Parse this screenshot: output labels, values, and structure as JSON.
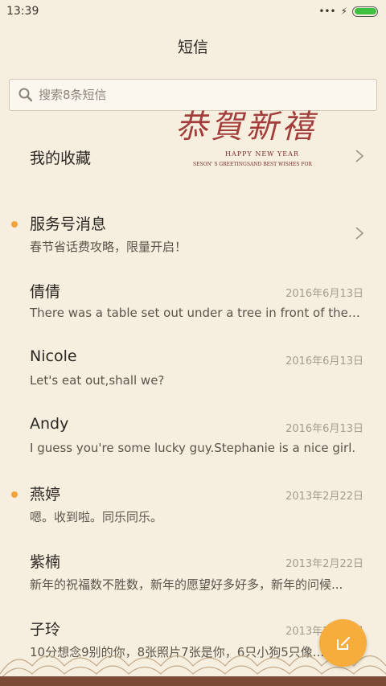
{
  "status": {
    "time": "13:39",
    "dots": "•••",
    "bolt": "⚡"
  },
  "header": {
    "title": "短信"
  },
  "search": {
    "placeholder": "搜索8条短信"
  },
  "decoration": {
    "main": "恭賀新禧",
    "sub1": "HAPPY NEW YEAR",
    "sub2": "SESON' S GREETINGSAND BEST WISHES FOR"
  },
  "conversations": [
    {
      "name": "我的收藏",
      "preview": "",
      "date": "",
      "unread": false,
      "chevron": true
    },
    {
      "name": "服务号消息",
      "preview": "春节省话费攻略，限量开启！",
      "date": "",
      "unread": true,
      "chevron": true
    },
    {
      "name": "倩倩",
      "preview": "There was a table set out under a tree in front of the ho...",
      "date": "2016年6月13日",
      "unread": false,
      "chevron": false
    },
    {
      "name": "Nicole",
      "preview": "Let's eat out,shall we?",
      "date": "2016年6月13日",
      "unread": false,
      "chevron": false
    },
    {
      "name": "Andy",
      "preview": "I guess you're some lucky guy.Stephanie is a nice girl.",
      "date": "2016年6月13日",
      "unread": false,
      "chevron": false
    },
    {
      "name": "燕婷",
      "preview": "嗯。收到啦。同乐同乐。",
      "date": "2013年2月22日",
      "unread": true,
      "chevron": false
    },
    {
      "name": "紫楠",
      "preview": "新年的祝福数不胜数，新年的愿望好多好多，新年的问候...",
      "date": "2013年2月22日",
      "unread": false,
      "chevron": false
    },
    {
      "name": "子玲",
      "preview": "10分想念9别的你，8张照片7张是你，6只小狗5只像...",
      "date": "2013年2月22日",
      "unread": false,
      "chevron": false
    }
  ],
  "colors": {
    "accent": "#f6ad3c",
    "background": "#f6efdf",
    "unread_dot": "#f4a23a"
  },
  "icons": {
    "search": "search-icon",
    "compose": "compose-icon",
    "chevron": "chevron-right-icon"
  }
}
